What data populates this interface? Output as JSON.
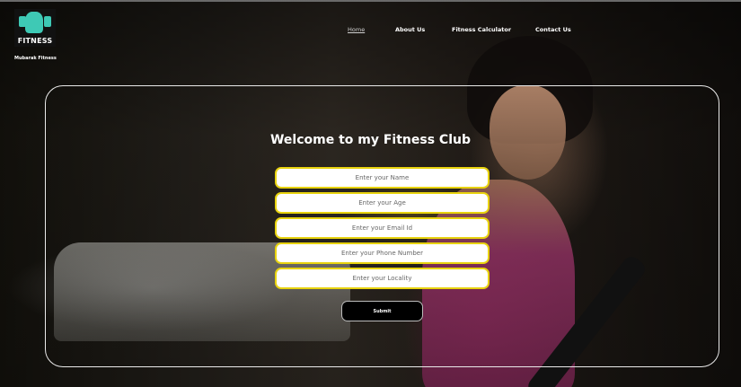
{
  "header": {
    "logo_text": "FITNESS",
    "brand_name": "Mubarak Fitness"
  },
  "nav": {
    "items": [
      {
        "label": "Home",
        "active": true
      },
      {
        "label": "About Us",
        "active": false
      },
      {
        "label": "Fitness Calculator",
        "active": false
      },
      {
        "label": "Contact Us",
        "active": false
      }
    ]
  },
  "form": {
    "title": "Welcome to my Fitness Club",
    "fields": [
      {
        "placeholder": "Enter your Name",
        "value": ""
      },
      {
        "placeholder": "Enter your Age",
        "value": ""
      },
      {
        "placeholder": "Enter your Email Id",
        "value": ""
      },
      {
        "placeholder": "Enter your Phone Number",
        "value": ""
      },
      {
        "placeholder": "Enter your Locality",
        "value": ""
      }
    ],
    "submit_label": "Submit"
  },
  "colors": {
    "field_border": "#e8d30f",
    "logo_accent": "#3ec9b5",
    "submit_bg": "#000000"
  },
  "icons": {
    "logo": "fitness-figure-dumbbell-icon"
  }
}
